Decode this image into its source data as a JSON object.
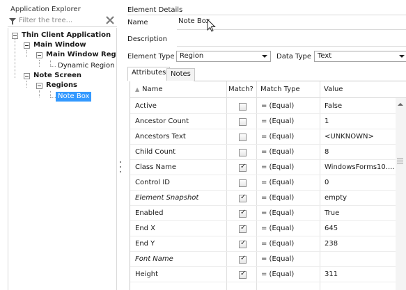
{
  "explorer": {
    "title": "Application Explorer",
    "filter_placeholder": "Filter the tree...",
    "tree": [
      {
        "label": "Thin Client Application"
      },
      {
        "label": "Main Window"
      },
      {
        "label": "Main Window Region"
      },
      {
        "label": "Dynamic Region"
      },
      {
        "label": "Note Screen"
      },
      {
        "label": "Regions"
      },
      {
        "label": "Note Box",
        "selected": true
      }
    ]
  },
  "details": {
    "section_title": "Element Details",
    "name_label": "Name",
    "name_value": "Note Box",
    "description_label": "Description",
    "element_type_label": "Element Type",
    "element_type_value": "Region",
    "data_type_label": "Data Type",
    "data_type_value": "Text",
    "tabs": [
      {
        "label": "Attributes",
        "active": true
      },
      {
        "label": "Notes",
        "active": false
      }
    ]
  },
  "grid": {
    "columns": [
      "Name",
      "Match?",
      "Match Type",
      "Value"
    ],
    "sort_indicator": "▲",
    "rows": [
      {
        "name": "Active",
        "match": false,
        "type": "= (Equal)",
        "value": "False",
        "italic": false
      },
      {
        "name": "Ancestor Count",
        "match": false,
        "type": "= (Equal)",
        "value": "1",
        "italic": false
      },
      {
        "name": "Ancestors Text",
        "match": false,
        "type": "= (Equal)",
        "value": "<UNKNOWN>",
        "italic": false
      },
      {
        "name": "Child Count",
        "match": false,
        "type": "= (Equal)",
        "value": "8",
        "italic": false
      },
      {
        "name": "Class Name",
        "match": true,
        "type": "= (Equal)",
        "value": "WindowsForms10....",
        "italic": false
      },
      {
        "name": "Control ID",
        "match": false,
        "type": "= (Equal)",
        "value": "0",
        "italic": false
      },
      {
        "name": "Element Snapshot",
        "match": true,
        "type": "= (Equal)",
        "value": "empty",
        "italic": true
      },
      {
        "name": "Enabled",
        "match": true,
        "type": "= (Equal)",
        "value": "True",
        "italic": false
      },
      {
        "name": "End X",
        "match": true,
        "type": "= (Equal)",
        "value": "645",
        "italic": false
      },
      {
        "name": "End Y",
        "match": true,
        "type": "= (Equal)",
        "value": "238",
        "italic": false
      },
      {
        "name": "Font Name",
        "match": true,
        "type": "= (Equal)",
        "value": "",
        "italic": true
      },
      {
        "name": "Height",
        "match": true,
        "type": "= (Equal)",
        "value": "311",
        "italic": false
      }
    ]
  },
  "colors": {
    "selection": "#3399ff",
    "border": "#d9d9d9"
  }
}
